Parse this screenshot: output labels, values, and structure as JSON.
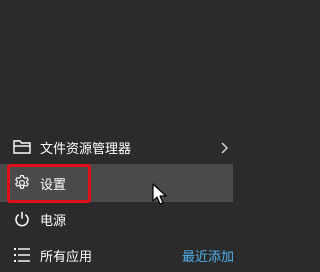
{
  "start_menu": {
    "file_explorer": {
      "label": "文件资源管理器",
      "icon": "folder-icon"
    },
    "settings": {
      "label": "设置",
      "icon": "gear-icon"
    },
    "power": {
      "label": "电源",
      "icon": "power-icon"
    },
    "all_apps": {
      "label": "所有应用",
      "icon": "list-icon",
      "recent_label": "最近添加"
    }
  },
  "colors": {
    "background": "#2b2b2b",
    "selected_row": "#4a4a4a",
    "highlight": "#e0101a",
    "accent_link": "#4fb3f0"
  }
}
